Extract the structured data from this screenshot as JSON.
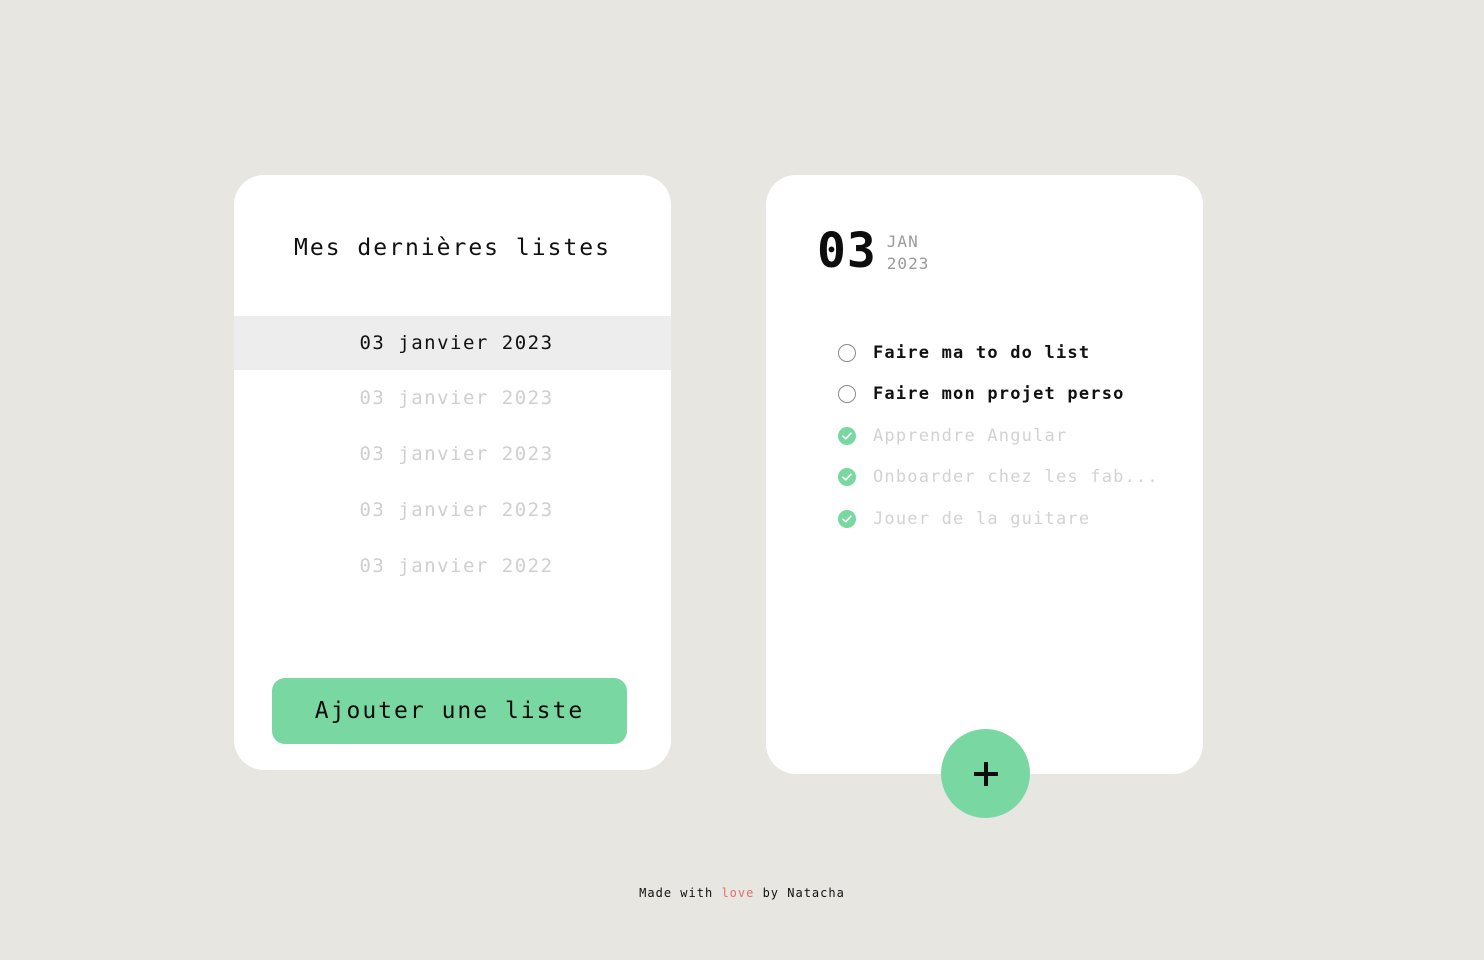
{
  "lists_panel": {
    "title": "Mes dernières listes",
    "items": [
      {
        "label": "03 janvier 2023",
        "active": true
      },
      {
        "label": "03 janvier 2023",
        "active": false
      },
      {
        "label": "03 janvier 2023",
        "active": false
      },
      {
        "label": "03 janvier 2023",
        "active": false
      },
      {
        "label": "03 janvier 2022",
        "active": false
      }
    ],
    "add_button_label": "Ajouter une liste"
  },
  "todo_panel": {
    "date": {
      "day": "03",
      "month": "JAN",
      "year": "2023"
    },
    "tasks": [
      {
        "label": "Faire ma to do list",
        "done": false
      },
      {
        "label": "Faire mon projet perso",
        "done": false
      },
      {
        "label": "Apprendre Angular",
        "done": true
      },
      {
        "label": "Onboarder chez les fab...",
        "done": true
      },
      {
        "label": "Jouer de la guitare",
        "done": true
      }
    ],
    "add_task_icon": "plus-icon"
  },
  "footer": {
    "prefix": "Made with",
    "highlight": "love",
    "suffix": "by Natacha"
  },
  "colors": {
    "background": "#e7e6e1",
    "accent": "#79d7a1",
    "love": "#e0706a",
    "card": "#ffffff"
  }
}
